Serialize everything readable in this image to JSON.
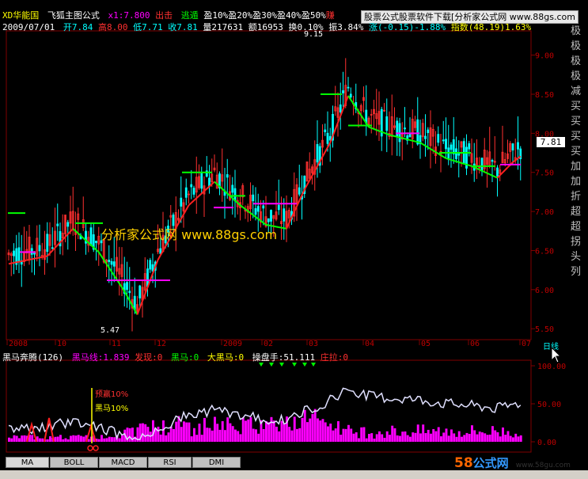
{
  "header": {
    "stock_name": "XD华能国",
    "formula_name": "飞狐主图公式",
    "price_label": "x1:7.800",
    "signal_out": "出击",
    "signal_escape": "逃遁",
    "profit_labels": [
      "盈10%",
      "盈20%",
      "盈30%",
      "盈40%",
      "盈50%"
    ],
    "earn_label": "赚",
    "date": "2009/07/01",
    "open": "开7.84",
    "high": "高8.00",
    "low": "低7.71",
    "close": "收7.81",
    "volume": "量217631",
    "amount": "额16953",
    "turnover": "换0.10%",
    "amplitude": "振3.84%",
    "change": "涨(-0.15)-1.88%",
    "index": "指数(48.19)1.63%"
  },
  "ad_text": "股票公式股票软件下载[分析家公式网 www.88gs.com",
  "right_side_labels": [
    "极",
    "极",
    "极",
    "极",
    "减",
    "买",
    "买",
    "买",
    "买",
    "加",
    "加",
    "折",
    "超",
    "超",
    "拐",
    "头",
    "列"
  ],
  "watermark": "分析家公式网 www.88gs.com",
  "main_chart": {
    "price_ticks": [
      "9.00",
      "8.50",
      "8.00",
      "7.50",
      "7.00",
      "6.50",
      "6.00",
      "5.50"
    ],
    "current_price": "7.81",
    "max_label": "9.15",
    "min_label": "5.47",
    "date_labels": [
      "2008",
      "10",
      "11",
      "12",
      "2009",
      "02",
      "03",
      "04",
      "05",
      "06",
      "07"
    ],
    "period": "日线"
  },
  "sub_chart": {
    "title": "黑马奔腾(126)",
    "line1": "黑马线:1.839",
    "line2": "发现:0",
    "line3": "黑马:0",
    "line4": "大黑马:0",
    "line5": "操盘手:51.111",
    "line6": "庄拉:0",
    "ticks": [
      "100.00",
      "50.00",
      "0.00"
    ],
    "annotation1": "预赢10%",
    "annotation2": "黑马10%"
  },
  "tabs": [
    "MA",
    "BOLL",
    "MACD",
    "RSI",
    "DMI"
  ],
  "brand": {
    "num": "58",
    "text": "公式网",
    "url": "www.58gu.com"
  },
  "chart_data": {
    "type": "candlestick",
    "title": "XD华能国",
    "y_range": [
      5.35,
      9.3
    ],
    "sub_y_range": [
      0,
      110
    ]
  }
}
